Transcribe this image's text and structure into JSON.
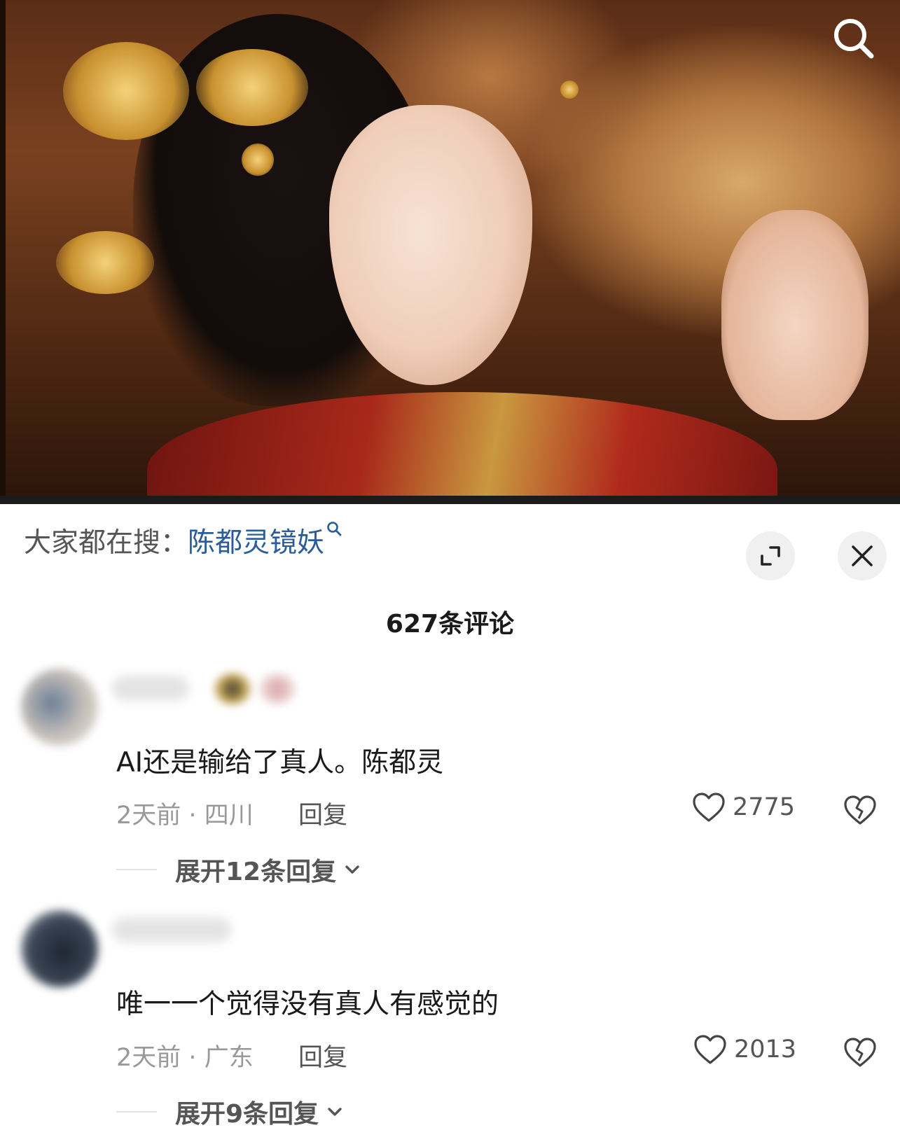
{
  "hero": {
    "search_icon": "search-icon"
  },
  "suggest": {
    "prefix": "大家都在搜：",
    "term": "陈都灵镜妖",
    "expand_icon": "expand-icon",
    "close_icon": "close-icon"
  },
  "comments_header": {
    "title": "627条评论"
  },
  "comments": [
    {
      "text": "AI还是输给了真人。陈都灵",
      "time": "2天前",
      "location": "四川",
      "reply_label": "回复",
      "likes": "2775",
      "expand_label": "展开12条回复"
    },
    {
      "text": "唯一一个觉得没有真人有感觉的",
      "time": "2天前",
      "location": "广东",
      "reply_label": "回复",
      "likes": "2013",
      "expand_label": "展开9条回复"
    }
  ],
  "colors": {
    "link": "#2a5c9b",
    "meta": "#999999"
  }
}
